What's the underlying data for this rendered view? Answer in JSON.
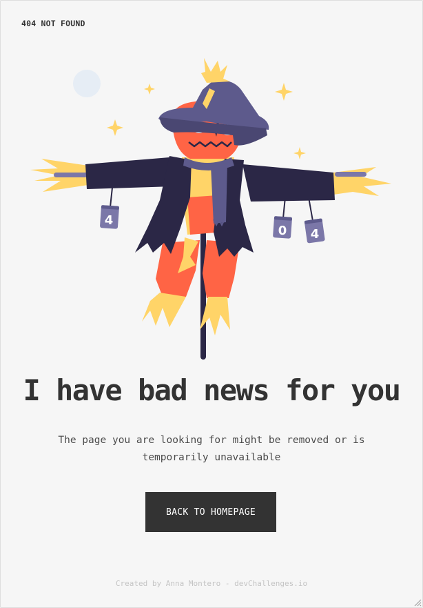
{
  "header": {
    "brand": "404 NOT FOUND"
  },
  "main": {
    "headline": "I have bad news for you",
    "subtitle": "The page you are looking for might be removed or is temporarily unavailable",
    "cta_label": "BACK TO HOMEPAGE"
  },
  "illustration": {
    "can_left_label": "4",
    "can_mid_label": "0",
    "can_right_label": "4",
    "icon": "scarecrow-illustration"
  },
  "footer": {
    "credit": "Created by Anna Montero - devChallenges.io"
  },
  "colors": {
    "background": "#f6f6f6",
    "text": "#333333",
    "button": "#333333",
    "coat": "#2b2746",
    "hat": "#5d5a8c",
    "face": "#ff6445",
    "straw": "#ffd468",
    "can": "#7b77a8"
  }
}
